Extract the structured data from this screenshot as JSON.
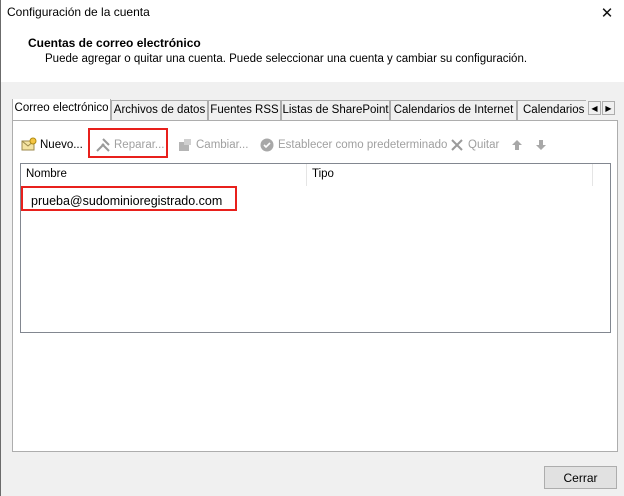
{
  "window": {
    "title": "Configuración de la cuenta"
  },
  "header": {
    "title": "Cuentas de correo electrónico",
    "subtitle": "Puede agregar o quitar una cuenta. Puede seleccionar una cuenta y cambiar su configuración."
  },
  "tabs": [
    {
      "label": "Correo electrónico"
    },
    {
      "label": "Archivos de datos"
    },
    {
      "label": "Fuentes RSS"
    },
    {
      "label": "Listas de SharePoint"
    },
    {
      "label": "Calendarios de Internet"
    },
    {
      "label": "Calendarios p"
    }
  ],
  "toolbar": {
    "new_label": "Nuevo...",
    "repair_label": "Reparar...",
    "change_label": "Cambiar...",
    "default_label": "Establecer como predeterminado",
    "remove_label": "Quitar"
  },
  "list": {
    "columns": [
      "Nombre",
      "Tipo"
    ],
    "rows": [
      {
        "name": "prueba@sudominioregistrado.com",
        "type": ""
      }
    ]
  },
  "footer": {
    "close_label": "Cerrar"
  },
  "colors": {
    "highlight": "#e8201c",
    "panel_border": "#adadad"
  }
}
